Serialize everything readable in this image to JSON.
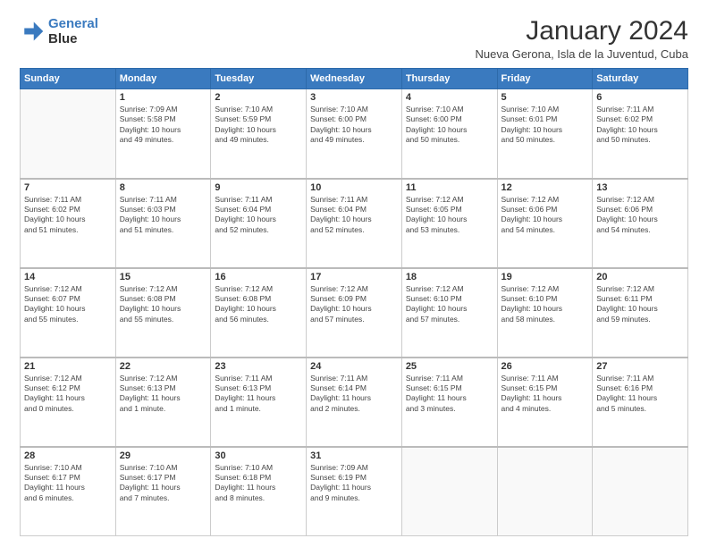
{
  "logo": {
    "line1": "General",
    "line2": "Blue"
  },
  "title": "January 2024",
  "subtitle": "Nueva Gerona, Isla de la Juventud, Cuba",
  "weekdays": [
    "Sunday",
    "Monday",
    "Tuesday",
    "Wednesday",
    "Thursday",
    "Friday",
    "Saturday"
  ],
  "weeks": [
    [
      {
        "day": "",
        "info": ""
      },
      {
        "day": "1",
        "info": "Sunrise: 7:09 AM\nSunset: 5:58 PM\nDaylight: 10 hours\nand 49 minutes."
      },
      {
        "day": "2",
        "info": "Sunrise: 7:10 AM\nSunset: 5:59 PM\nDaylight: 10 hours\nand 49 minutes."
      },
      {
        "day": "3",
        "info": "Sunrise: 7:10 AM\nSunset: 6:00 PM\nDaylight: 10 hours\nand 49 minutes."
      },
      {
        "day": "4",
        "info": "Sunrise: 7:10 AM\nSunset: 6:00 PM\nDaylight: 10 hours\nand 50 minutes."
      },
      {
        "day": "5",
        "info": "Sunrise: 7:10 AM\nSunset: 6:01 PM\nDaylight: 10 hours\nand 50 minutes."
      },
      {
        "day": "6",
        "info": "Sunrise: 7:11 AM\nSunset: 6:02 PM\nDaylight: 10 hours\nand 50 minutes."
      }
    ],
    [
      {
        "day": "7",
        "info": "Sunrise: 7:11 AM\nSunset: 6:02 PM\nDaylight: 10 hours\nand 51 minutes."
      },
      {
        "day": "8",
        "info": "Sunrise: 7:11 AM\nSunset: 6:03 PM\nDaylight: 10 hours\nand 51 minutes."
      },
      {
        "day": "9",
        "info": "Sunrise: 7:11 AM\nSunset: 6:04 PM\nDaylight: 10 hours\nand 52 minutes."
      },
      {
        "day": "10",
        "info": "Sunrise: 7:11 AM\nSunset: 6:04 PM\nDaylight: 10 hours\nand 52 minutes."
      },
      {
        "day": "11",
        "info": "Sunrise: 7:12 AM\nSunset: 6:05 PM\nDaylight: 10 hours\nand 53 minutes."
      },
      {
        "day": "12",
        "info": "Sunrise: 7:12 AM\nSunset: 6:06 PM\nDaylight: 10 hours\nand 54 minutes."
      },
      {
        "day": "13",
        "info": "Sunrise: 7:12 AM\nSunset: 6:06 PM\nDaylight: 10 hours\nand 54 minutes."
      }
    ],
    [
      {
        "day": "14",
        "info": "Sunrise: 7:12 AM\nSunset: 6:07 PM\nDaylight: 10 hours\nand 55 minutes."
      },
      {
        "day": "15",
        "info": "Sunrise: 7:12 AM\nSunset: 6:08 PM\nDaylight: 10 hours\nand 55 minutes."
      },
      {
        "day": "16",
        "info": "Sunrise: 7:12 AM\nSunset: 6:08 PM\nDaylight: 10 hours\nand 56 minutes."
      },
      {
        "day": "17",
        "info": "Sunrise: 7:12 AM\nSunset: 6:09 PM\nDaylight: 10 hours\nand 57 minutes."
      },
      {
        "day": "18",
        "info": "Sunrise: 7:12 AM\nSunset: 6:10 PM\nDaylight: 10 hours\nand 57 minutes."
      },
      {
        "day": "19",
        "info": "Sunrise: 7:12 AM\nSunset: 6:10 PM\nDaylight: 10 hours\nand 58 minutes."
      },
      {
        "day": "20",
        "info": "Sunrise: 7:12 AM\nSunset: 6:11 PM\nDaylight: 10 hours\nand 59 minutes."
      }
    ],
    [
      {
        "day": "21",
        "info": "Sunrise: 7:12 AM\nSunset: 6:12 PM\nDaylight: 11 hours\nand 0 minutes."
      },
      {
        "day": "22",
        "info": "Sunrise: 7:12 AM\nSunset: 6:13 PM\nDaylight: 11 hours\nand 1 minute."
      },
      {
        "day": "23",
        "info": "Sunrise: 7:11 AM\nSunset: 6:13 PM\nDaylight: 11 hours\nand 1 minute."
      },
      {
        "day": "24",
        "info": "Sunrise: 7:11 AM\nSunset: 6:14 PM\nDaylight: 11 hours\nand 2 minutes."
      },
      {
        "day": "25",
        "info": "Sunrise: 7:11 AM\nSunset: 6:15 PM\nDaylight: 11 hours\nand 3 minutes."
      },
      {
        "day": "26",
        "info": "Sunrise: 7:11 AM\nSunset: 6:15 PM\nDaylight: 11 hours\nand 4 minutes."
      },
      {
        "day": "27",
        "info": "Sunrise: 7:11 AM\nSunset: 6:16 PM\nDaylight: 11 hours\nand 5 minutes."
      }
    ],
    [
      {
        "day": "28",
        "info": "Sunrise: 7:10 AM\nSunset: 6:17 PM\nDaylight: 11 hours\nand 6 minutes."
      },
      {
        "day": "29",
        "info": "Sunrise: 7:10 AM\nSunset: 6:17 PM\nDaylight: 11 hours\nand 7 minutes."
      },
      {
        "day": "30",
        "info": "Sunrise: 7:10 AM\nSunset: 6:18 PM\nDaylight: 11 hours\nand 8 minutes."
      },
      {
        "day": "31",
        "info": "Sunrise: 7:09 AM\nSunset: 6:19 PM\nDaylight: 11 hours\nand 9 minutes."
      },
      {
        "day": "",
        "info": ""
      },
      {
        "day": "",
        "info": ""
      },
      {
        "day": "",
        "info": ""
      }
    ]
  ]
}
